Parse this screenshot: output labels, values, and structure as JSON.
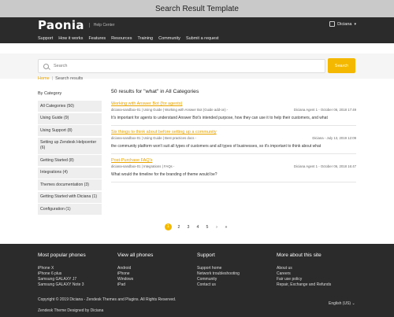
{
  "window": {
    "title": "Search Result Template"
  },
  "header": {
    "logo": "Paonia",
    "logo_sub": "Help Center",
    "user_name": "Diciana"
  },
  "nav": [
    "Support",
    "How it works",
    "Features",
    "Resources",
    "Training",
    "Community",
    "Submit a request"
  ],
  "search": {
    "placeholder": "Search",
    "button": "Search"
  },
  "breadcrumb": {
    "home": "Home",
    "current": "Search results"
  },
  "sidebar": {
    "heading": "By Category",
    "categories": [
      "All Categories (50)",
      "Using Guide (9)",
      "Using Support (8)",
      "Setting up Zendesk Helpcenter (6)",
      "Getting Started (8)",
      "Integrations (4)",
      "Themes documentation (3)",
      "Getting Started with Diciana (1)",
      "Configuration (1)"
    ]
  },
  "results": {
    "heading": "50 results for \"what\" in All Categories",
    "items": [
      {
        "title": "Working with Answer Bot (for agents)",
        "meta": "diciana-sandbox-01 | Using Guide | Working with Answer Bot (Guide add-on) -",
        "author_date": "Diciana Agent 1 -  October 06, 2018 17:49",
        "snippet": "It's important for agents to understand Answer Bot's intended purpose, how they can use it to help their customers, and what"
      },
      {
        "title": "Six things to think about before setting up a community",
        "meta": "diciana-sandbox-01 | Using Guide | Best practices docs -",
        "author_date": "Diciana -  July 13, 2019 12:09",
        "snippet": "the community platform won't suit all types of customers and all types of businesses, so it's important to think about what"
      },
      {
        "title": "Post-Purchase FAQ's",
        "meta": "diciana-sandbox-01 | Integrations | FAQs -",
        "author_date": "Diciana Agent 1 -  October 06, 2018 16:47",
        "snippet": "What would the timeline for the branding of theme would be?"
      }
    ]
  },
  "pagination": {
    "pages": [
      "1",
      "2",
      "3",
      "4",
      "5"
    ],
    "next": "›",
    "last": "»"
  },
  "footer": {
    "columns": [
      {
        "heading": "Most popular phones",
        "links": [
          "iPhone X",
          "iPhone 6 plus",
          "Samsung GALAXY J7",
          "Samsung GALAXY Note 3"
        ]
      },
      {
        "heading": "View all phones",
        "links": [
          "Android",
          "iPhone",
          "Windows",
          "iPad"
        ]
      },
      {
        "heading": "Support",
        "links": [
          "Support home",
          "Network troubleshooting",
          "Community",
          "Contact us"
        ]
      },
      {
        "heading": "More about this site",
        "links": [
          "About us",
          "Careers",
          "Fair use policy",
          "Repair, Exchange and Refunds"
        ]
      }
    ],
    "copyright": "Copyright © 2019 Diciana - Zendesk Themes and Plugins. All Rights Reserved.",
    "credit": "Zendesk Theme Designed by Diciana",
    "language": "English (US) ⌄"
  },
  "colors": {
    "accent": "#f4b800",
    "dark": "#2b2b2b",
    "link": "#e8a300"
  }
}
